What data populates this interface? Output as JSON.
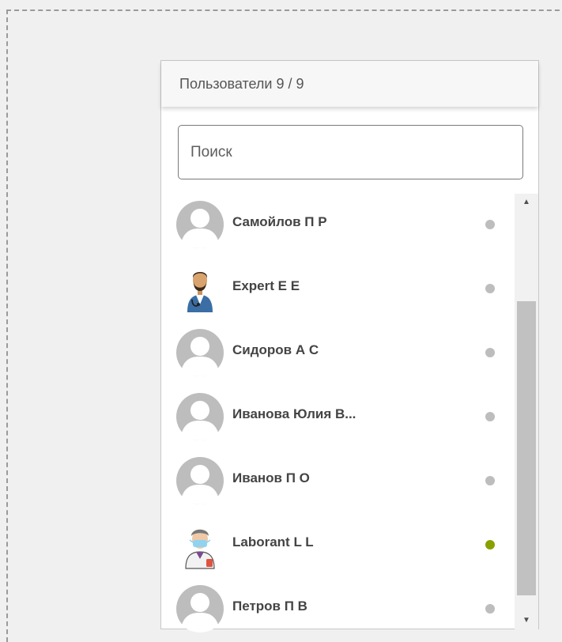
{
  "panel": {
    "title": "Пользователи 9 / 9"
  },
  "search": {
    "placeholder": "Поиск",
    "value": ""
  },
  "users": [
    {
      "name": "Самойлов П Р",
      "avatar": "default-avatar-icon",
      "status": "offline",
      "status_color": "#bdbdbd"
    },
    {
      "name": "Expert E E",
      "avatar": "doctor-avatar-icon",
      "status": "offline",
      "status_color": "#bdbdbd"
    },
    {
      "name": "Сидоров А С",
      "avatar": "default-avatar-icon",
      "status": "offline",
      "status_color": "#bdbdbd"
    },
    {
      "name": "Иванова Юлия В...",
      "avatar": "default-avatar-icon",
      "status": "offline",
      "status_color": "#bdbdbd"
    },
    {
      "name": "Иванов П О",
      "avatar": "default-avatar-icon",
      "status": "offline",
      "status_color": "#bdbdbd"
    },
    {
      "name": "Laborant L L",
      "avatar": "lab-assistant-avatar-icon",
      "status": "online",
      "status_color": "#8aa000"
    },
    {
      "name": "Петров П В",
      "avatar": "default-avatar-icon",
      "status": "offline",
      "status_color": "#bdbdbd"
    }
  ],
  "scrollbar": {
    "up_icon": "triangle-up-icon",
    "down_icon": "triangle-down-icon",
    "position_fraction": 0.25
  }
}
